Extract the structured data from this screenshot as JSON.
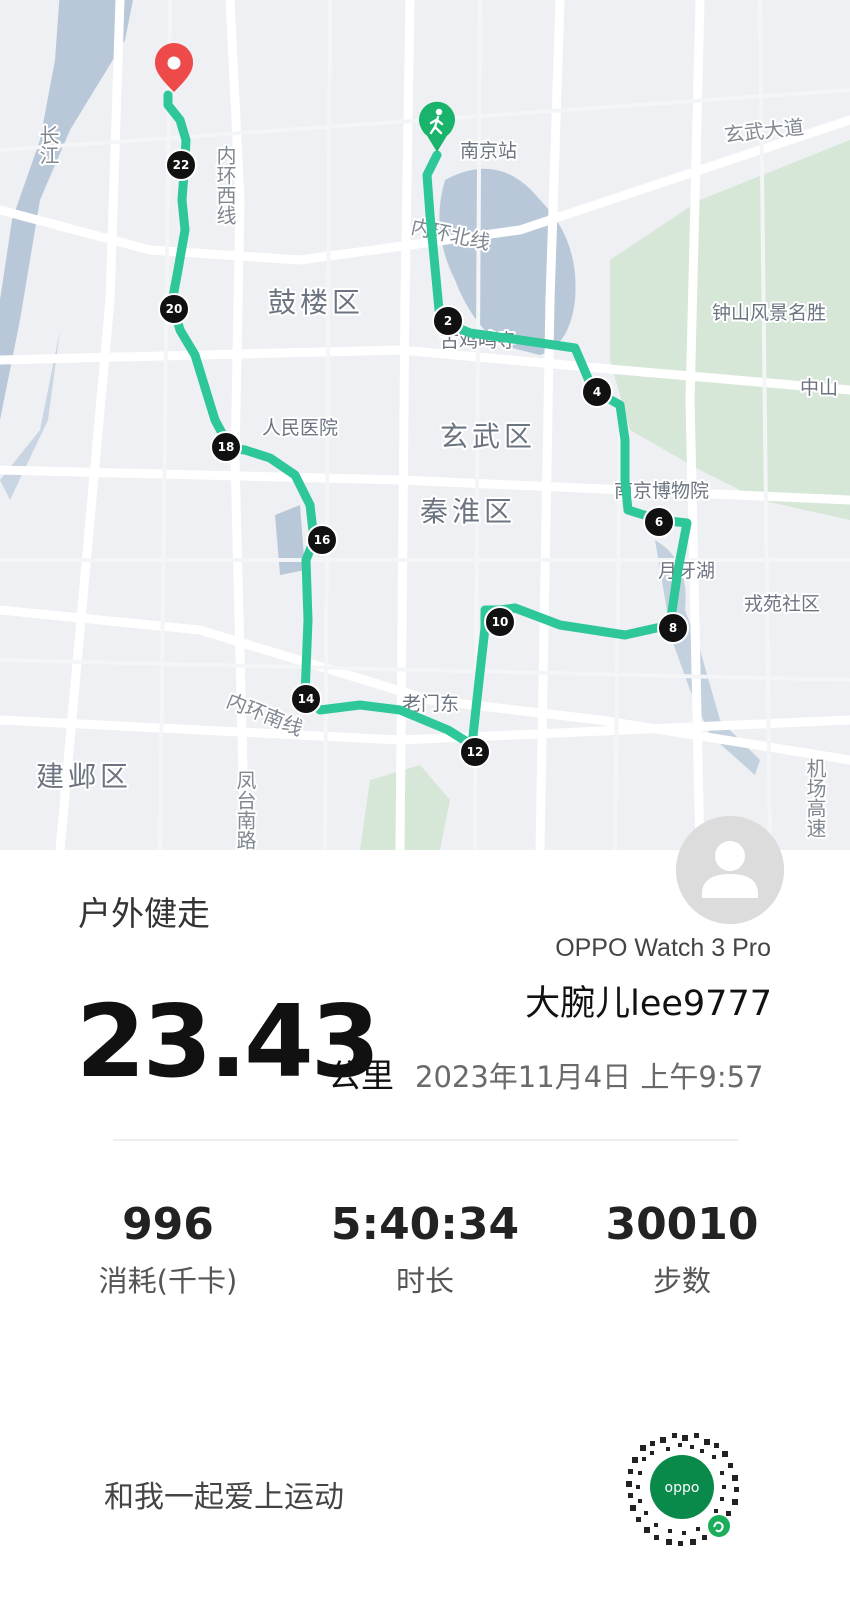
{
  "map": {
    "districts": [
      "鼓楼区",
      "玄武区",
      "秦淮区",
      "建邺区"
    ],
    "pois": [
      "南京站",
      "人民医院",
      "南京博物院",
      "月牙湖",
      "戎苑社区",
      "钟山风景名胜",
      "中山",
      "古鸡鸣寺",
      "老门东"
    ],
    "roads": [
      "玄武大道",
      "内环北线",
      "内环西线",
      "内环南线",
      "长江",
      "凤台南路",
      "机场高速"
    ],
    "km_markers": [
      "2",
      "4",
      "6",
      "8",
      "10",
      "12",
      "14",
      "16",
      "18",
      "20",
      "22"
    ],
    "start_icon": "walker-icon",
    "end_icon": "location-pin-icon",
    "route_color": "#2ec79a"
  },
  "activity_type": "户外健走",
  "device": "OPPO Watch 3 Pro",
  "username": "大腕儿lee9777",
  "distance": {
    "value": "23.43",
    "unit": "公里"
  },
  "datetime": "2023年11月4日 上午9:57",
  "stats": [
    {
      "value": "996",
      "label": "消耗(千卡)"
    },
    {
      "value": "5:40:34",
      "label": "时长"
    },
    {
      "value": "30010",
      "label": "步数"
    }
  ],
  "slogan": "和我一起爱上运动",
  "qr": {
    "brand_text": "oppo",
    "icon": "mini-program-qr-code"
  }
}
